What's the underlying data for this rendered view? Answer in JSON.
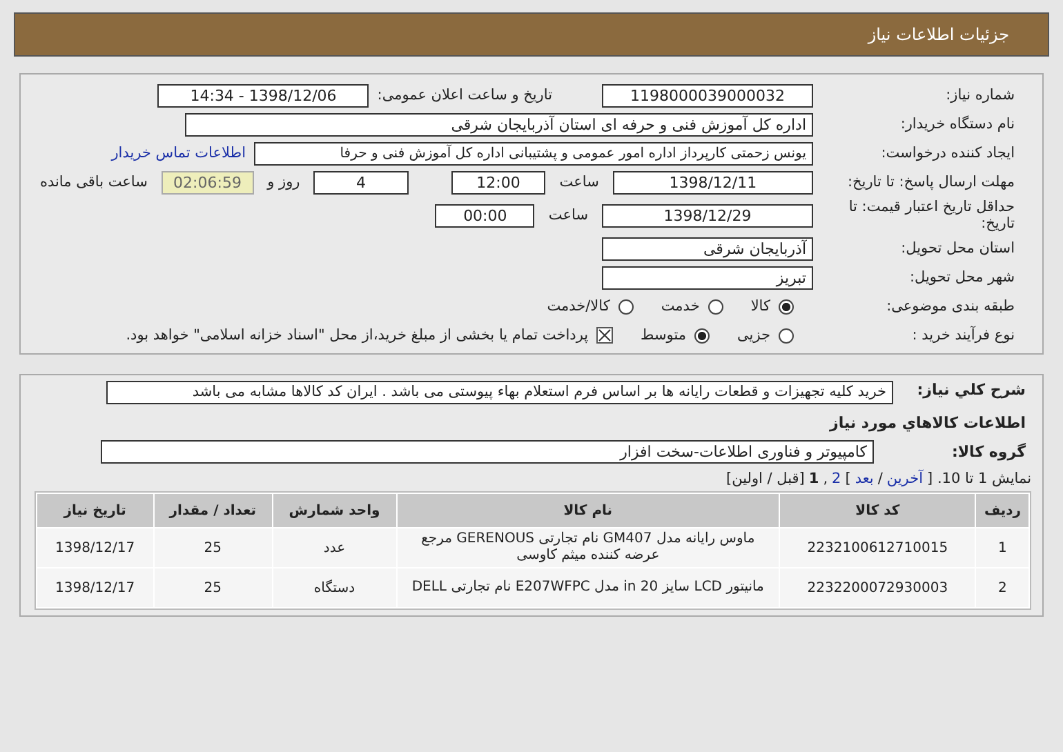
{
  "header": {
    "title": "جزئیات اطلاعات نیاز"
  },
  "details": {
    "need_number": {
      "label": "شماره نیاز:",
      "value": "1198000039000032"
    },
    "announce": {
      "label": "تاریخ و ساعت اعلان عمومی:",
      "value": "1398/12/06 - 14:34"
    },
    "buyer": {
      "label": "نام دستگاه خریدار:",
      "value": "اداره کل آموزش فنی و حرفه ای استان آذربایجان شرقی"
    },
    "creator": {
      "label": "ایجاد کننده درخواست:",
      "value": "یونس زحمتی کارپرداز اداره امور عمومی و پشتیبانی اداره کل آموزش فنی و حرفا",
      "link": "اطلاعات تماس خریدار"
    },
    "deadline": {
      "label": "مهلت ارسال پاسخ: تا تاریخ:",
      "date": "1398/12/11",
      "time_label": "ساعت",
      "time": "12:00",
      "days": "4",
      "days_label": "روز و",
      "remaining": "02:06:59",
      "remaining_label": "ساعت باقی مانده"
    },
    "validity": {
      "label": "حداقل تاریخ اعتبار قیمت: تا تاریخ:",
      "date": "1398/12/29",
      "time_label": "ساعت",
      "time": "00:00"
    },
    "province": {
      "label": "استان محل تحویل:",
      "value": "آذربایجان شرقی"
    },
    "city": {
      "label": "شهر محل تحویل:",
      "value": "تبریز"
    },
    "category": {
      "label": "طبقه بندی موضوعی:",
      "options": [
        {
          "label": "کالا",
          "selected": true
        },
        {
          "label": "خدمت",
          "selected": false
        },
        {
          "label": "کالا/خدمت",
          "selected": false
        }
      ]
    },
    "process": {
      "label": "نوع فرآیند خرید :",
      "options": [
        {
          "label": "جزیی",
          "selected": false
        },
        {
          "label": "متوسط",
          "selected": true
        }
      ],
      "treasury": {
        "label": "پرداخت تمام یا بخشی از مبلغ خرید،از محل \"اسناد خزانه اسلامی\" خواهد بود.",
        "checked": true
      }
    }
  },
  "summary": {
    "label": "شرح کلي نياز:",
    "value": "خرید کلیه تجهیزات و قطعات رایانه ها بر اساس فرم استعلام بهاء پیوستی می باشد . ایران کد کالاها مشابه می باشد"
  },
  "goods": {
    "title": "اطلاعات کالاهاي مورد نياز",
    "group_label": "گروه کالا:",
    "group": "کامپیوتر و فناوری اطلاعات-سخت افزار",
    "pagination": [
      {
        "text": "نمایش 1 تا 10. [",
        "kind": "text"
      },
      {
        "text": "آخرین",
        "kind": "link"
      },
      {
        "text": "/",
        "kind": "text"
      },
      {
        "text": "بعد",
        "kind": "link"
      },
      {
        "text": "]",
        "kind": "text"
      },
      {
        "text": "2",
        "kind": "link"
      },
      {
        "text": ",",
        "kind": "text"
      },
      {
        "text": "1",
        "kind": "current"
      },
      {
        "text": "[قبل / اولین]",
        "kind": "text"
      }
    ],
    "table": {
      "columns": [
        "رديف",
        "کد کالا",
        "نام کالا",
        "واحد شمارش",
        "تعداد / مقدار",
        "تاریخ نیاز"
      ],
      "rows": [
        [
          "1",
          "2232100612710015",
          "ماوس رایانه مدل GM407 نام تجارتی GERENOUS مرجع عرضه کننده میثم کاوسی",
          "عدد",
          "25",
          "1398/12/17"
        ],
        [
          "2",
          "2232200072930003",
          "مانیتور LCD سایز 20 in مدل E207WFPC نام تجارتی DELL",
          "دستگاه",
          "25",
          "1398/12/17"
        ]
      ]
    }
  }
}
